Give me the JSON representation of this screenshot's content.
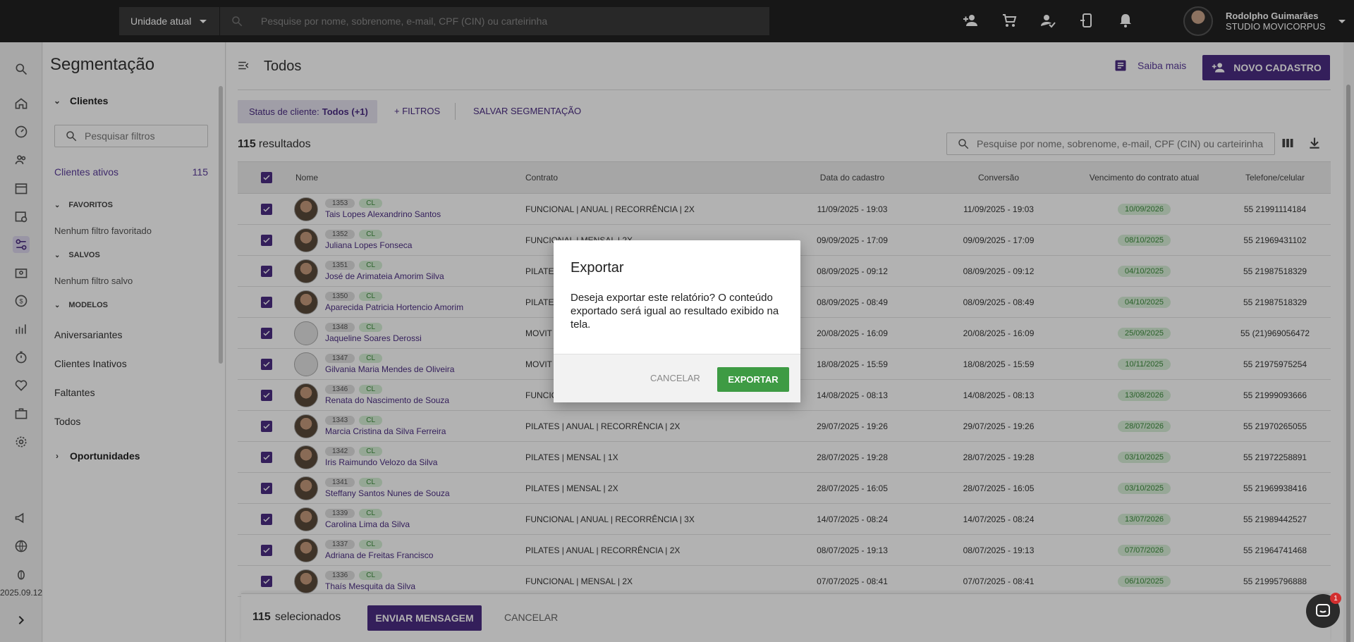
{
  "topbar": {
    "unit": "Unidade atual",
    "search_placeholder": "Pesquise por nome, sobrenome, e-mail, CPF (CIN) ou carteirinha",
    "icons": [
      "add-person-icon",
      "cart-icon",
      "person-check-icon",
      "device-icon",
      "bell-icon"
    ],
    "user_name": "Rodolpho Guimarães",
    "user_org": "STUDIO MOVICORPUS"
  },
  "rail": {
    "icons": [
      "search-icon",
      "home-icon",
      "dashboard-icon",
      "people-icon",
      "calendar-icon",
      "schedule-icon",
      "segment-icon",
      "badge-icon",
      "money-icon",
      "chart-icon",
      "timer-icon",
      "heart-icon",
      "briefcase-icon",
      "gear-icon",
      "megaphone-icon",
      "globe-icon",
      "bug-icon"
    ],
    "version": "2025.09.12"
  },
  "segmentation": {
    "title": "Segmentação",
    "clients_section": "Clientes",
    "filter_placeholder": "Pesquisar filtros",
    "active_clients_label": "Clientes ativos",
    "active_clients_count": "115",
    "favorites_label": "FAVORITOS",
    "favorites_empty": "Nenhum filtro favoritado",
    "saved_label": "SALVOS",
    "saved_empty": "Nenhum filtro salvo",
    "models_label": "MODELOS",
    "models": [
      "Aniversariantes",
      "Clientes Inativos",
      "Faltantes",
      "Todos"
    ],
    "opportunities_label": "Oportunidades"
  },
  "main": {
    "title": "Todos",
    "saiba_mais": "Saiba mais",
    "novo_cadastro": "NOVO CADASTRO",
    "status_label": "Status de cliente:",
    "status_value": "Todos (+1)",
    "filtros": "+ FILTROS",
    "salvar": "SALVAR SEGMENTAÇÃO",
    "results_count": "115",
    "results_label": "resultados",
    "table_search_placeholder": "Pesquise por nome, sobrenome, e-mail, CPF (CIN) ou carteirinha"
  },
  "table": {
    "headers": {
      "nome": "Nome",
      "contrato": "Contrato",
      "data": "Data do cadastro",
      "conversao": "Conversão",
      "vencimento": "Vencimento do contrato atual",
      "telefone": "Telefone/celular"
    },
    "rows": [
      {
        "id": "1353",
        "tag": "CL",
        "name": "Tais Lopes Alexandrino Santos",
        "contract": "FUNCIONAL | ANUAL | RECORRÊNCIA | 2X",
        "created": "11/09/2025 - 19:03",
        "conversion": "11/09/2025 - 19:03",
        "due": "10/09/2026",
        "phone": "55 21991114184",
        "blank": false
      },
      {
        "id": "1352",
        "tag": "CL",
        "name": "Juliana Lopes Fonseca",
        "contract": "FUNCIONAL | MENSAL | 2X",
        "created": "09/09/2025 - 17:09",
        "conversion": "09/09/2025 - 17:09",
        "due": "08/10/2025",
        "phone": "55 21969431102",
        "blank": false
      },
      {
        "id": "1351",
        "tag": "CL",
        "name": "José de Arimateia Amorim Silva",
        "contract": "PILATES | MENSAL | 2X",
        "created": "08/09/2025 - 09:12",
        "conversion": "08/09/2025 - 09:12",
        "due": "04/10/2025",
        "phone": "55 21987518329",
        "blank": false
      },
      {
        "id": "1350",
        "tag": "CL",
        "name": "Aparecida Patricia Hortencio Amorim",
        "contract": "PILATES | MENSAL | 2X",
        "created": "08/09/2025 - 08:49",
        "conversion": "08/09/2025 - 08:49",
        "due": "04/10/2025",
        "phone": "55 21987518329",
        "blank": false
      },
      {
        "id": "1348",
        "tag": "CL",
        "name": "Jaqueline Soares Derossi",
        "contract": "MOVIT | MENSAL | 2X",
        "created": "20/08/2025 - 16:09",
        "conversion": "20/08/2025 - 16:09",
        "due": "25/09/2025",
        "phone": "55 (21)969056472",
        "blank": true
      },
      {
        "id": "1347",
        "tag": "CL",
        "name": "Gilvania Maria Mendes de Oliveira",
        "contract": "MOVIT | MENSAL | 2X",
        "created": "18/08/2025 - 15:59",
        "conversion": "18/08/2025 - 15:59",
        "due": "10/11/2025",
        "phone": "55 21975975254",
        "blank": true
      },
      {
        "id": "1346",
        "tag": "CL",
        "name": "Renata do Nascimento de Souza",
        "contract": "FUNCIONAL | ANUAL | RECORRÊNCIA | 2X",
        "created": "14/08/2025 - 08:13",
        "conversion": "14/08/2025 - 08:13",
        "due": "13/08/2026",
        "phone": "55 21999093666",
        "blank": false
      },
      {
        "id": "1343",
        "tag": "CL",
        "name": "Marcia Cristina da Silva Ferreira",
        "contract": "PILATES | ANUAL | RECORRÊNCIA | 2X",
        "created": "29/07/2025 - 19:26",
        "conversion": "29/07/2025 - 19:26",
        "due": "28/07/2026",
        "phone": "55 21970265055",
        "blank": false
      },
      {
        "id": "1342",
        "tag": "CL",
        "name": "Iris Raimundo Velozo da Silva",
        "contract": "PILATES | MENSAL | 1X",
        "created": "28/07/2025 - 19:28",
        "conversion": "28/07/2025 - 19:28",
        "due": "03/10/2025",
        "phone": "55 21972258891",
        "blank": false
      },
      {
        "id": "1341",
        "tag": "CL",
        "name": "Steffany Santos Nunes de Souza",
        "contract": "PILATES | MENSAL | 2X",
        "created": "28/07/2025 - 16:05",
        "conversion": "28/07/2025 - 16:05",
        "due": "03/10/2025",
        "phone": "55 21969938416",
        "blank": false
      },
      {
        "id": "1339",
        "tag": "CL",
        "name": "Carolina Lima da Silva",
        "contract": "FUNCIONAL | ANUAL | RECORRÊNCIA | 3X",
        "created": "14/07/2025 - 08:24",
        "conversion": "14/07/2025 - 08:24",
        "due": "13/07/2026",
        "phone": "55 21989442527",
        "blank": false
      },
      {
        "id": "1337",
        "tag": "CL",
        "name": "Adriana de Freitas Francisco",
        "contract": "PILATES | ANUAL | RECORRÊNCIA | 2X",
        "created": "08/07/2025 - 19:13",
        "conversion": "08/07/2025 - 19:13",
        "due": "07/07/2026",
        "phone": "55 21964741468",
        "blank": false
      },
      {
        "id": "1336",
        "tag": "CL",
        "name": "Thaís Mesquita da Silva",
        "contract": "FUNCIONAL | MENSAL | 2X",
        "created": "07/07/2025 - 08:41",
        "conversion": "07/07/2025 - 08:41",
        "due": "06/10/2025",
        "phone": "55 21995796888",
        "blank": false
      }
    ]
  },
  "bottom": {
    "selected_count": "115",
    "selected_label": "selecionados",
    "send_message": "ENVIAR MENSAGEM",
    "cancel": "CANCELAR"
  },
  "dialog": {
    "title": "Exportar",
    "body": "Deseja exportar este relatório? O conteúdo exportado será igual ao resultado exibido na tela.",
    "cancel": "CANCELAR",
    "confirm": "EXPORTAR"
  },
  "chat": {
    "badge": "1"
  },
  "colors": {
    "primary": "#4b2d83",
    "success": "#3e9b44",
    "topbar": "#222222"
  }
}
